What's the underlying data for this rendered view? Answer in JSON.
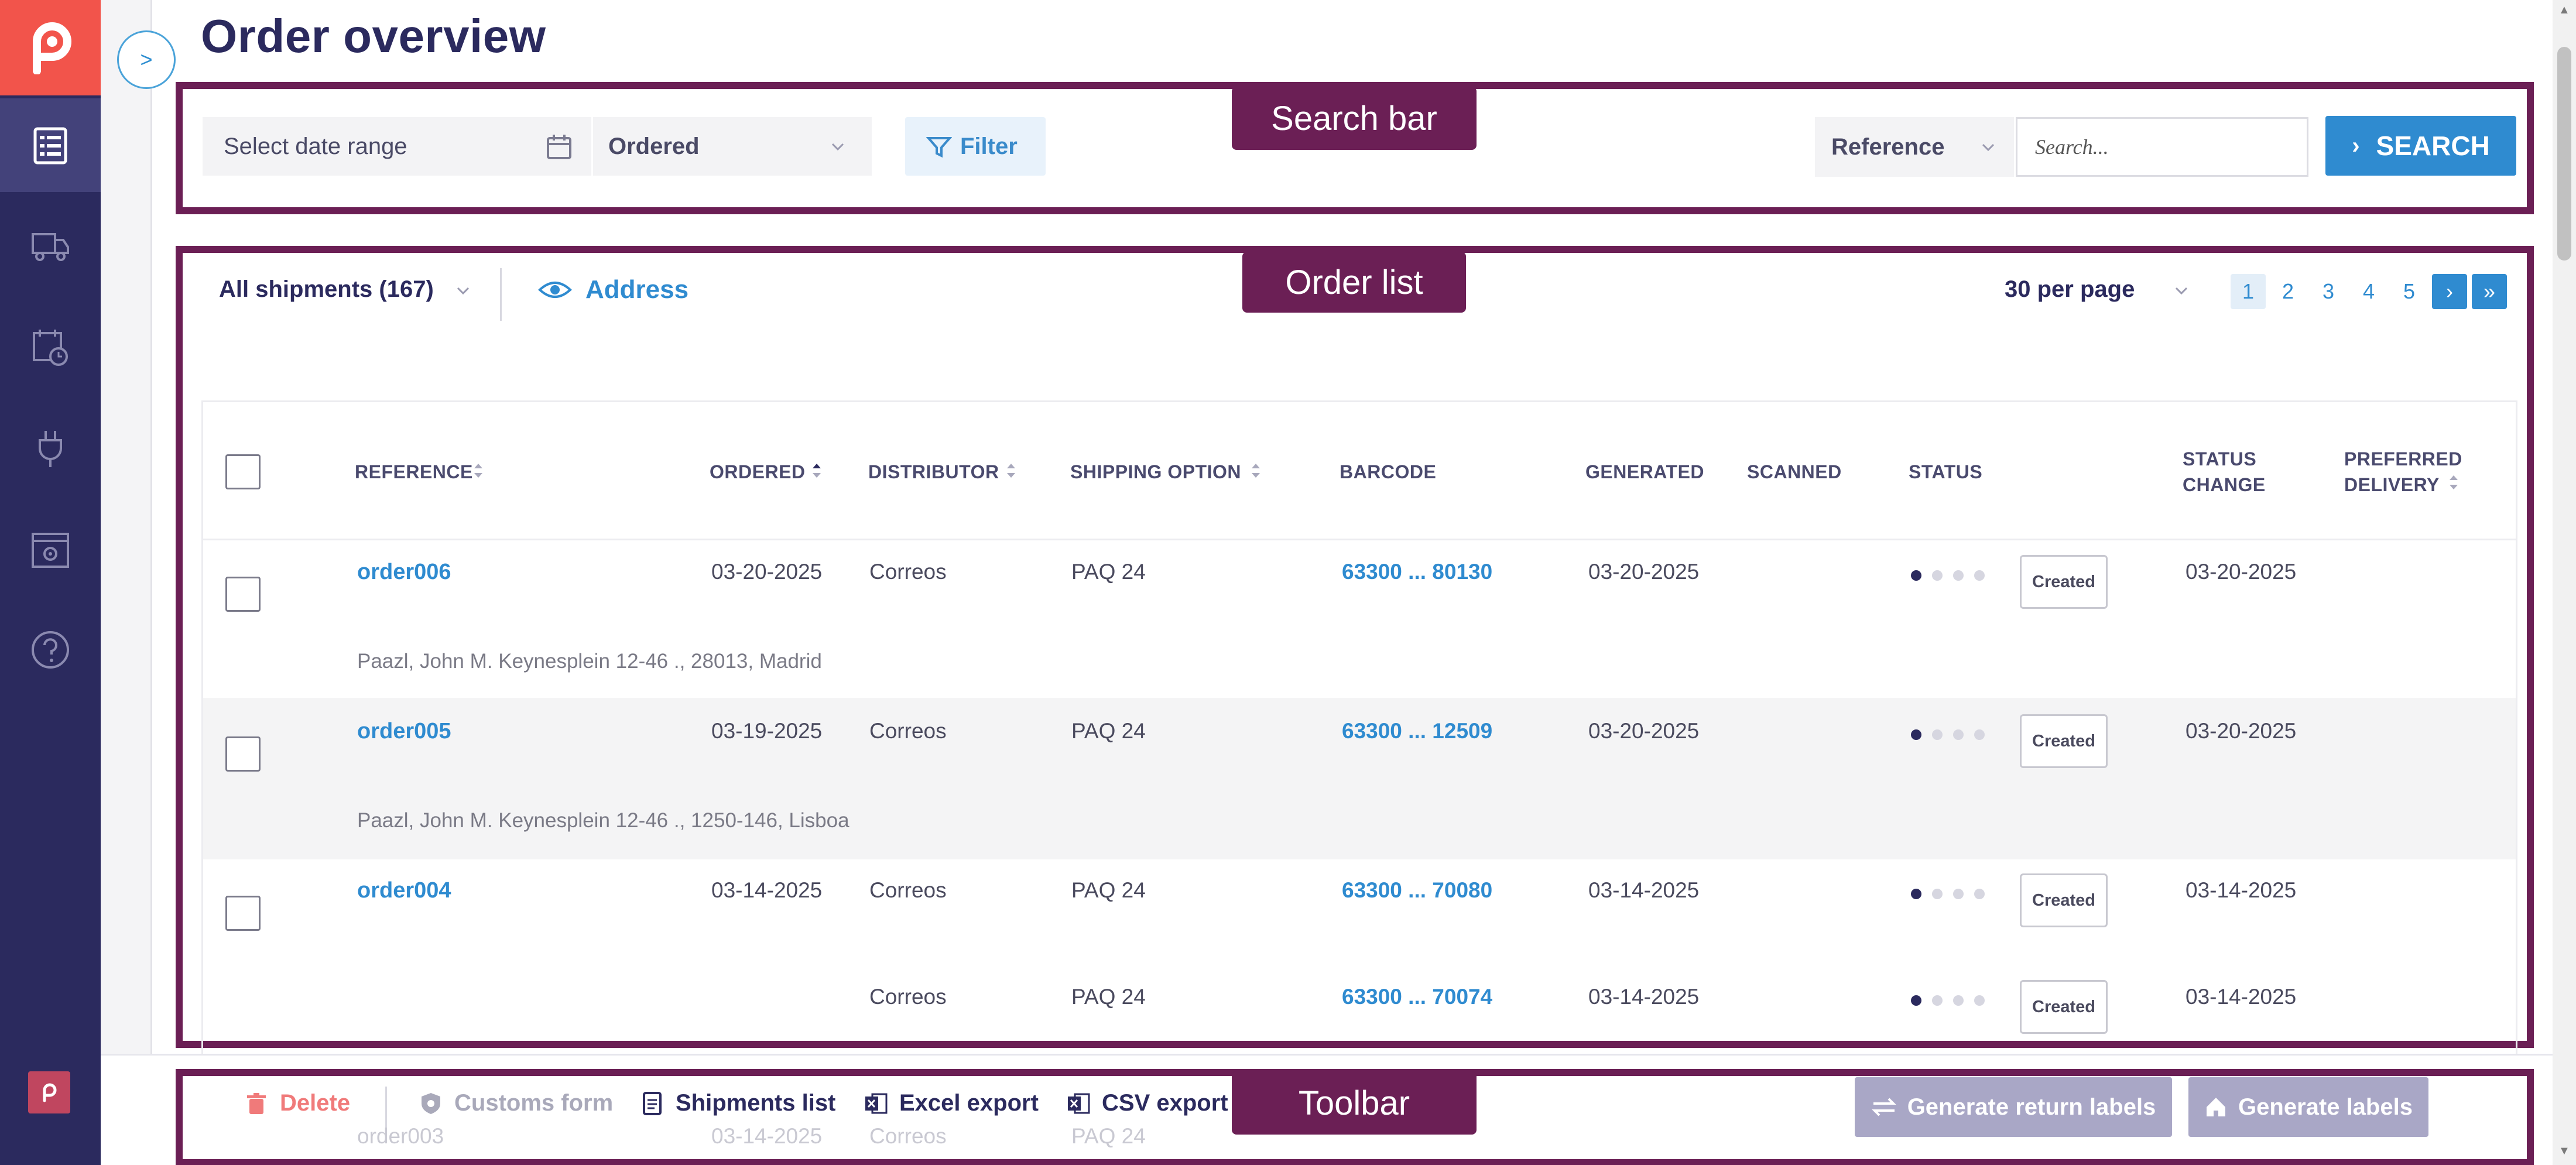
{
  "page": {
    "title": "Order overview",
    "expand_label": ">"
  },
  "annotations": {
    "search_bar": "Search bar",
    "order_list": "Order list",
    "toolbar": "Toolbar"
  },
  "search": {
    "date_range_placeholder": "Select date range",
    "date_type": "Ordered",
    "filter_label": "Filter",
    "field_select": "Reference",
    "input_placeholder": "Search...",
    "button_label": "SEARCH",
    "button_chevron": "›"
  },
  "list": {
    "shipments_filter": "All shipments (167)",
    "address_toggle": "Address",
    "per_page": "30 per page",
    "pages": [
      "1",
      "2",
      "3",
      "4",
      "5"
    ],
    "next": "›",
    "last": "»"
  },
  "table": {
    "headers": {
      "reference": "REFERENCE",
      "ordered": "ORDERED",
      "distributor": "DISTRIBUTOR",
      "shipping_option": "SHIPPING OPTION",
      "barcode": "BARCODE",
      "generated": "GENERATED",
      "scanned": "SCANNED",
      "status": "STATUS",
      "status_change_1": "STATUS",
      "status_change_2": "CHANGE",
      "preferred_delivery_1": "PREFERRED",
      "preferred_delivery_2": "DELIVERY"
    },
    "rows": [
      {
        "reference": "order006",
        "ordered": "03-20-2025",
        "distributor": "Correos",
        "shipping_option": "PAQ 24",
        "barcode": "63300 ... 80130",
        "generated": "03-20-2025",
        "status": "Created",
        "status_change": "03-20-2025",
        "address": "Paazl, John M. Keynesplein 12-46 ., 28013, Madrid"
      },
      {
        "reference": "order005",
        "ordered": "03-19-2025",
        "distributor": "Correos",
        "shipping_option": "PAQ 24",
        "barcode": "63300 ... 12509",
        "generated": "03-20-2025",
        "status": "Created",
        "status_change": "03-20-2025",
        "address": "Paazl, John M. Keynesplein 12-46 ., 1250-146, Lisboa"
      },
      {
        "reference": "order004",
        "ordered": "03-14-2025",
        "distributor": "Correos",
        "shipping_option": "PAQ 24",
        "barcode": "63300 ... 70080",
        "generated": "03-14-2025",
        "status": "Created",
        "status_change": "03-14-2025"
      },
      {
        "distributor": "Correos",
        "shipping_option": "PAQ 24",
        "barcode": "63300 ... 70074",
        "generated": "03-14-2025",
        "status": "Created",
        "status_change": "03-14-2025"
      }
    ]
  },
  "toolbar": {
    "delete": "Delete",
    "customs_form": "Customs form",
    "shipments_list": "Shipments list",
    "excel_export": "Excel export",
    "csv_export": "CSV export",
    "generate_return_labels": "Generate return labels",
    "generate_labels": "Generate labels",
    "partial_row": [
      "order003",
      "03-14-2025",
      "Correos",
      "PAQ 24"
    ]
  },
  "colors": {
    "sidebar": "#2b2a5e",
    "brand": "#f2544b",
    "accent": "#2f8bd0",
    "annotation": "#6b1f55",
    "delete": "#f07a7a"
  },
  "icons": {
    "sidebar": [
      "list-icon",
      "truck-icon",
      "calendar-clock-icon",
      "plug-icon",
      "settings-window-icon",
      "help-icon"
    ],
    "toolbar": [
      "trash-icon",
      "shield-icon",
      "document-icon",
      "excel-icon",
      "excel-icon",
      "return-arrows-icon",
      "home-icon"
    ]
  }
}
